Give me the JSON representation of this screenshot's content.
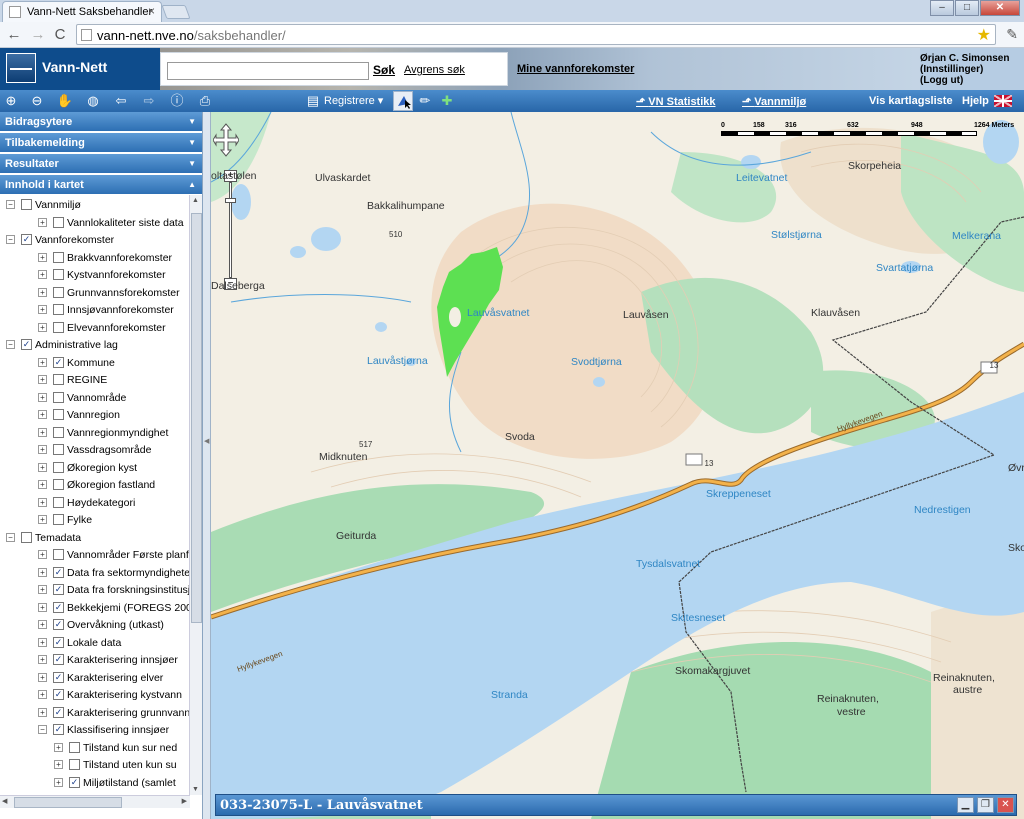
{
  "browser": {
    "tab_title": "Vann-Nett Saksbehandler",
    "tab_close": "×",
    "url_host": "vann-nett.nve.no",
    "url_path": "/saksbehandler/",
    "back_label": "←",
    "forward_label": "→",
    "reload_label": "C",
    "star_label": "★",
    "wrench_label": "✎",
    "min_label": "–",
    "max_label": "□",
    "close_label": "✕"
  },
  "header": {
    "app_title": "Vann-Nett",
    "search_placeholder": "",
    "search_button": "Søk",
    "advanced_search": "Avgrens søk",
    "mine_link": "Mine vannforekomster",
    "user_name": "Ørjan C. Simonsen",
    "user_settings": "(Innstillinger)",
    "user_logout": "(Logg ut)"
  },
  "toolbar": {
    "registrere": "Registrere",
    "vn_statistikk": "VN Statistikk",
    "vannmiljo": "Vannmiljø",
    "vis_kartlagsliste": "Vis kartlagsliste",
    "hjelp": "Hjelp"
  },
  "sidebar": {
    "accordion": [
      "Bidragsytere",
      "Tilbakemelding",
      "Resultater",
      "Innhold i kartet"
    ],
    "tree": [
      {
        "level": 0,
        "expander": "⊟",
        "checked": false,
        "label": "Vannmiljø"
      },
      {
        "level": 1,
        "expander": "⊞",
        "checked": false,
        "label": "Vannlokaliteter siste data"
      },
      {
        "level": 0,
        "expander": "⊟",
        "checked": true,
        "label": "Vannforekomster"
      },
      {
        "level": 1,
        "expander": "⊞",
        "checked": false,
        "label": "Brakkvannforekomster"
      },
      {
        "level": 1,
        "expander": "⊞",
        "checked": false,
        "label": "Kystvannforekomster"
      },
      {
        "level": 1,
        "expander": "⊞",
        "checked": false,
        "label": "Grunnvannsforekomster"
      },
      {
        "level": 1,
        "expander": "⊞",
        "checked": false,
        "label": "Innsjøvannforekomster"
      },
      {
        "level": 1,
        "expander": "⊞",
        "checked": false,
        "label": "Elvevannforekomster"
      },
      {
        "level": 0,
        "expander": "⊟",
        "checked": true,
        "label": "Administrative lag"
      },
      {
        "level": 1,
        "expander": "⊞",
        "checked": true,
        "label": "Kommune"
      },
      {
        "level": 1,
        "expander": "⊞",
        "checked": false,
        "label": "REGINE"
      },
      {
        "level": 1,
        "expander": "⊞",
        "checked": false,
        "label": "Vannområde"
      },
      {
        "level": 1,
        "expander": "⊞",
        "checked": false,
        "label": "Vannregion"
      },
      {
        "level": 1,
        "expander": "⊞",
        "checked": false,
        "label": "Vannregionmyndighet"
      },
      {
        "level": 1,
        "expander": "⊞",
        "checked": false,
        "label": "Vassdragsområde"
      },
      {
        "level": 1,
        "expander": "⊞",
        "checked": false,
        "label": "Økoregion kyst"
      },
      {
        "level": 1,
        "expander": "⊞",
        "checked": false,
        "label": "Økoregion fastland"
      },
      {
        "level": 1,
        "expander": "⊞",
        "checked": false,
        "label": "Høydekategori"
      },
      {
        "level": 1,
        "expander": "⊞",
        "checked": false,
        "label": "Fylke"
      },
      {
        "level": 0,
        "expander": "⊟",
        "checked": false,
        "label": "Temadata"
      },
      {
        "level": 1,
        "expander": "⊞",
        "checked": false,
        "label": "Vannområder Første planfa"
      },
      {
        "level": 1,
        "expander": "⊞",
        "checked": true,
        "label": "Data fra sektormyndighete"
      },
      {
        "level": 1,
        "expander": "⊞",
        "checked": true,
        "label": "Data fra forskningsinstitusj"
      },
      {
        "level": 1,
        "expander": "⊞",
        "checked": true,
        "label": "Bekkekjemi (FOREGS 2008"
      },
      {
        "level": 1,
        "expander": "⊞",
        "checked": true,
        "label": "Overvåkning (utkast)"
      },
      {
        "level": 1,
        "expander": "⊞",
        "checked": true,
        "label": "Lokale data"
      },
      {
        "level": 1,
        "expander": "⊞",
        "checked": true,
        "label": "Karakterisering innsjøer"
      },
      {
        "level": 1,
        "expander": "⊞",
        "checked": true,
        "label": "Karakterisering elver"
      },
      {
        "level": 1,
        "expander": "⊞",
        "checked": true,
        "label": "Karakterisering kystvann"
      },
      {
        "level": 1,
        "expander": "⊞",
        "checked": true,
        "label": "Karakterisering grunnvann"
      },
      {
        "level": 1,
        "expander": "⊟",
        "checked": true,
        "label": "Klassifisering innsjøer"
      },
      {
        "level": 2,
        "expander": "⊞",
        "checked": false,
        "label": "Tilstand kun sur ned"
      },
      {
        "level": 2,
        "expander": "⊞",
        "checked": false,
        "label": "Tilstand uten kun su"
      },
      {
        "level": 2,
        "expander": "⊞",
        "checked": true,
        "label": "Miljøtilstand (samlet"
      }
    ]
  },
  "map": {
    "scale_labels": [
      "0",
      "158",
      "316",
      "632",
      "948",
      "1264 Meters"
    ],
    "labels": [
      {
        "text": "oltastølen",
        "cls": "dark"
      },
      {
        "text": "Ulvaskardet",
        "cls": "dark"
      },
      {
        "text": "Bakkalihumpane",
        "cls": "dark"
      },
      {
        "text": "510",
        "cls": "dark"
      },
      {
        "text": "Dalseberga",
        "cls": "dark"
      },
      {
        "text": "Lauvåsvatnet",
        "cls": "water"
      },
      {
        "text": "Lauvåstjørna",
        "cls": "water"
      },
      {
        "text": "Lauvåsen",
        "cls": "dark"
      },
      {
        "text": "Svodtjørna",
        "cls": "water"
      },
      {
        "text": "Svoda",
        "cls": "dark"
      },
      {
        "text": "517",
        "cls": "dark"
      },
      {
        "text": "Midknuten",
        "cls": "dark"
      },
      {
        "text": "Leitevatnet",
        "cls": "water"
      },
      {
        "text": "Skorpeheia",
        "cls": "dark"
      },
      {
        "text": "Stølstjørna",
        "cls": "water"
      },
      {
        "text": "Melkerana",
        "cls": "water"
      },
      {
        "text": "Svartatjørna",
        "cls": "water"
      },
      {
        "text": "Klauvåsen",
        "cls": "dark"
      },
      {
        "text": "13",
        "cls": "dark"
      },
      {
        "text": "13",
        "cls": "dark"
      },
      {
        "text": "Hyllykevegen",
        "cls": "dark"
      },
      {
        "text": "Skreppeneset",
        "cls": "water"
      },
      {
        "text": "Nedrestigen",
        "cls": "water"
      },
      {
        "text": "Øvr",
        "cls": "dark"
      },
      {
        "text": "Geiturda",
        "cls": "dark"
      },
      {
        "text": "Hyllykevegen",
        "cls": "dark"
      },
      {
        "text": "Tysdalsvatnet",
        "cls": "water"
      },
      {
        "text": "Skitesneset",
        "cls": "water"
      },
      {
        "text": "Sko",
        "cls": "dark"
      },
      {
        "text": "Skomakargjuvet",
        "cls": "dark"
      },
      {
        "text": "Stranda",
        "cls": "water"
      },
      {
        "text": "Reinaknuten,",
        "cls": "dark"
      },
      {
        "text": "austre",
        "cls": "dark"
      },
      {
        "text": "Reinaknuten,",
        "cls": "dark"
      },
      {
        "text": "vestre",
        "cls": "dark"
      }
    ]
  },
  "bottom_panel": {
    "title": "033-23075-L - Lauvåsvatnet"
  }
}
